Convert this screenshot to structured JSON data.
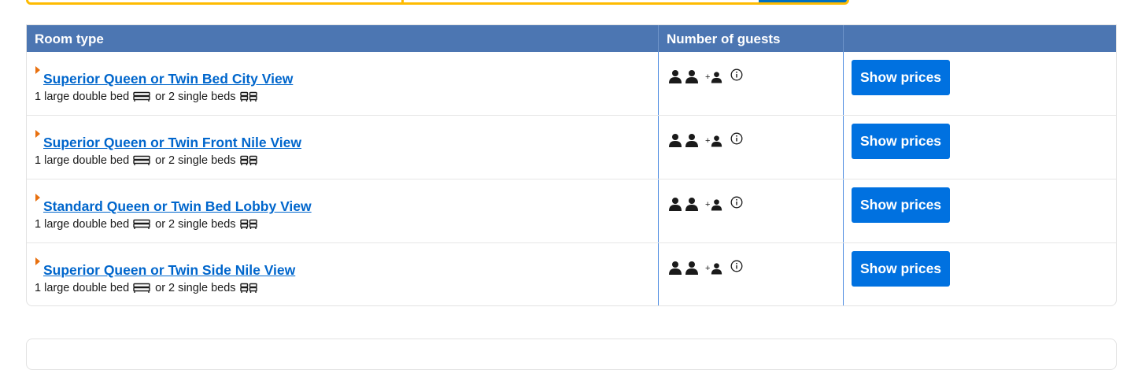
{
  "table": {
    "headers": {
      "room_type": "Room type",
      "guests": "Number of guests",
      "action": ""
    },
    "rows": [
      {
        "room_name": "Superior Queen or Twin Bed City View",
        "bed_double": "1 large double bed",
        "bed_or": "or 2 single beds",
        "guests_extra": "+",
        "button": "Show prices"
      },
      {
        "room_name": "Superior Queen or Twin Front Nile View",
        "bed_double": "1 large double bed",
        "bed_or": "or 2 single beds",
        "guests_extra": "+",
        "button": "Show prices"
      },
      {
        "room_name": "Standard Queen or Twin Bed Lobby View",
        "bed_double": "1 large double bed",
        "bed_or": "or 2 single beds",
        "guests_extra": "+",
        "button": "Show prices"
      },
      {
        "room_name": "Superior Queen or Twin Side Nile View",
        "bed_double": "1 large double bed",
        "bed_or": "or 2 single beds",
        "guests_extra": "+",
        "button": "Show prices"
      }
    ]
  },
  "icons": {
    "expand": "triangle-right-icon",
    "double_bed": "double-bed-icon",
    "single_beds": "single-beds-icon",
    "person": "person-icon",
    "info": "info-icon"
  },
  "colors": {
    "header_bg": "#4c76b2",
    "link": "#0066cc",
    "button": "#0071e0",
    "search_border": "#febb02",
    "expand_arrow": "#e8700f"
  }
}
